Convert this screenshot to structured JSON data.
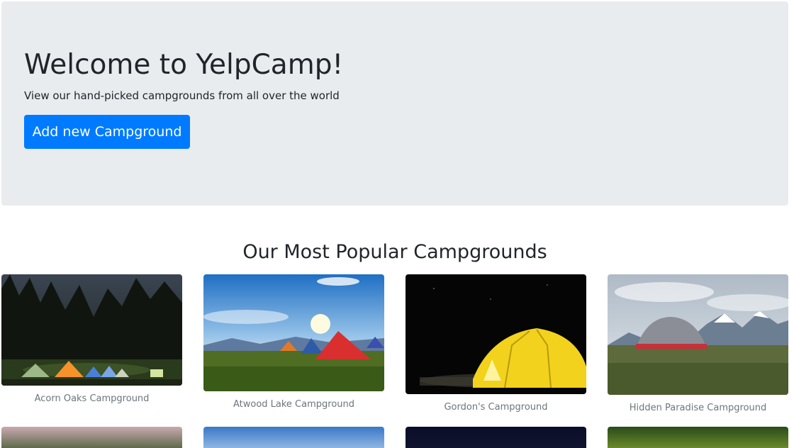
{
  "jumbotron": {
    "title": "Welcome to YelpCamp!",
    "subtitle": "View our hand-picked campgrounds from all over the world",
    "add_button_label": "Add new Campground"
  },
  "section": {
    "heading": "Our Most Popular Campgrounds"
  },
  "campgrounds": [
    {
      "name": "Acorn Oaks Campground",
      "image": "night-forest-tents-photo"
    },
    {
      "name": "Atwood Lake Campground",
      "image": "sunny-meadow-tents-photo"
    },
    {
      "name": "Gordon's Campground",
      "image": "yellow-tent-night-photo"
    },
    {
      "name": "Hidden Paradise Campground",
      "image": "mountain-tent-photo"
    }
  ],
  "colors": {
    "primary": "#007bff",
    "jumbotron_bg": "#e9ecef",
    "caption": "#6c757d"
  }
}
